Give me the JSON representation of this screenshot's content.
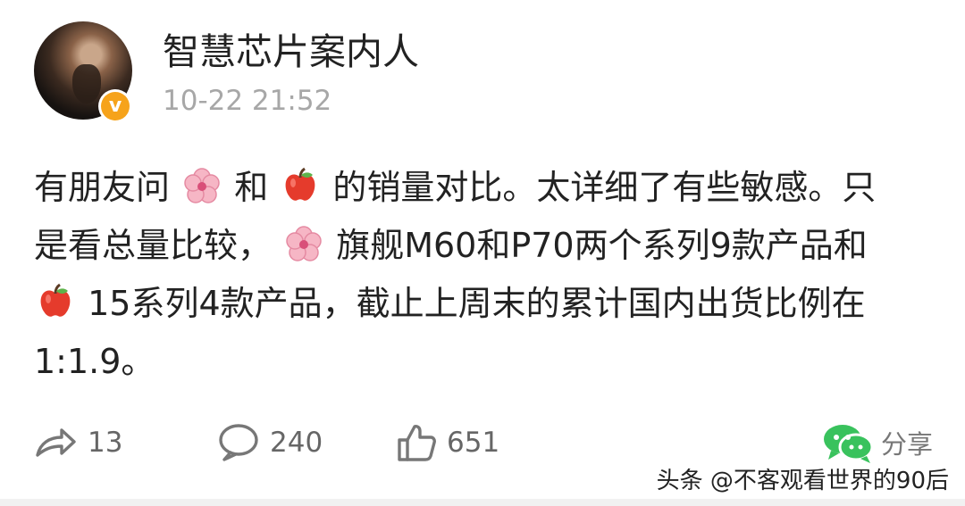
{
  "post": {
    "author": "智慧芯片案内人",
    "timestamp": "10-22 21:52",
    "content_parts": {
      "line1_a": "有朋友问",
      "line1_b": "和",
      "line1_c": "的销量对比。太详细了有些敏感。只",
      "line2_a": "是看总量比较，",
      "line2_b": "旗舰M60和P70两个系列9款产品和",
      "line3_b": "15系列4款产品，截止上周末的累计国内出货比例在",
      "line4": "1:1.9。"
    }
  },
  "actions": {
    "repost_count": "13",
    "comment_count": "240",
    "like_count": "651",
    "share_label": "分享"
  },
  "watermark": "头条 @不客观看世界的90后",
  "icons": {
    "avatar": "portrait-avatar",
    "verified": "verified-badge-icon",
    "flower": "cherry-blossom-emoji",
    "apple": "red-apple-emoji",
    "repost": "repost-arrow-icon",
    "comment": "comment-bubble-icon",
    "like": "thumbs-up-icon",
    "share": "wechat-share-icon"
  },
  "colors": {
    "verified_badge": "#f6a31b",
    "secondary_text": "#a7a7a7",
    "action_text": "#666666",
    "wechat_green": "#39c25d"
  }
}
